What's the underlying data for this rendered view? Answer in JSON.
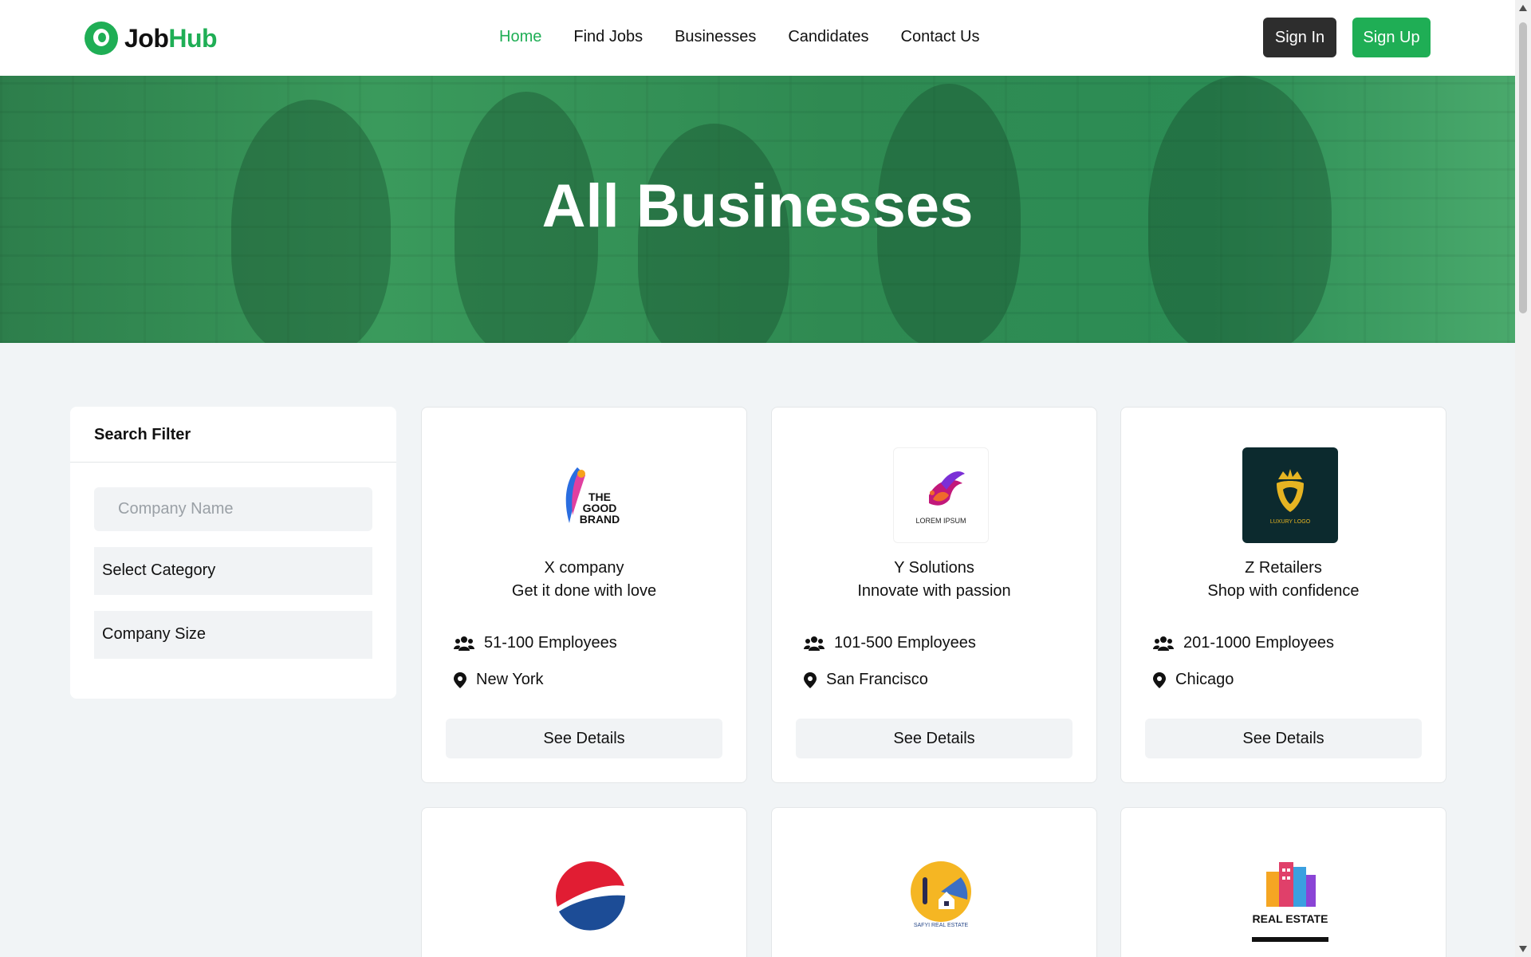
{
  "brand": {
    "part1": "Job",
    "part2": "Hub"
  },
  "nav": [
    "Home",
    "Find Jobs",
    "Businesses",
    "Candidates",
    "Contact Us"
  ],
  "auth": {
    "signin": "Sign In",
    "signup": "Sign Up"
  },
  "hero": {
    "title": "All Businesses"
  },
  "filter": {
    "title": "Search Filter",
    "company_name_placeholder": "Company Name",
    "category": "Select Category",
    "size": "Company Size"
  },
  "colors": {
    "accent": "#1fae55",
    "dark_button": "#2d2d2d",
    "page_bg": "#f1f4f6"
  },
  "businesses": [
    {
      "name": "X company",
      "tagline": "Get it done with love",
      "employees": "51-100 Employees",
      "location": "New York",
      "cta": "See Details",
      "logo_text": "THE GOOD BRAND"
    },
    {
      "name": "Y Solutions",
      "tagline": "Innovate with passion",
      "employees": "101-500 Employees",
      "location": "San Francisco",
      "cta": "See Details",
      "logo_text": "LOREM IPSUM"
    },
    {
      "name": "Z Retailers",
      "tagline": "Shop with confidence",
      "employees": "201-1000 Employees",
      "location": "Chicago",
      "cta": "See Details",
      "logo_text": "LUXURY LOGO"
    },
    {
      "logo_text": ""
    },
    {
      "logo_text": "SAFYI REAL ESTATE"
    },
    {
      "logo_text": "REAL ESTATE"
    }
  ]
}
